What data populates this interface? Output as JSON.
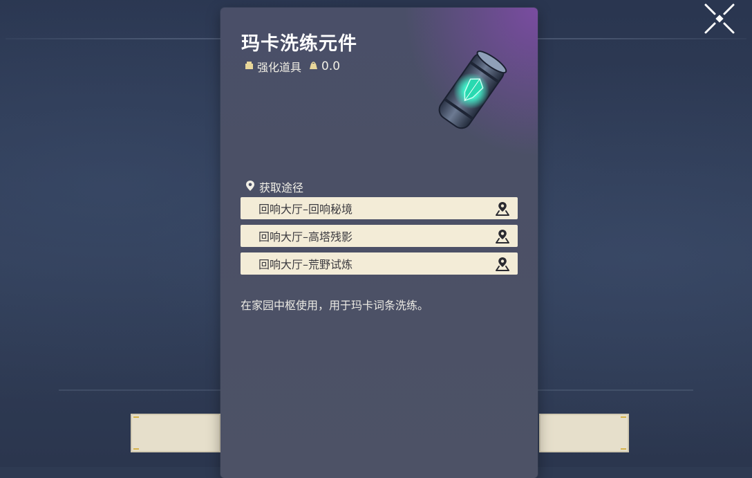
{
  "item": {
    "name": "玛卡洗练元件",
    "type_label": "强化道具",
    "value_label": "0.0",
    "icon_name": "energy-cylinder-icon",
    "description": "在家园中枢使用，用于玛卡词条洗练。"
  },
  "sources": {
    "header": "获取途径",
    "items": [
      {
        "label": "回响大厅–回响秘境",
        "icon": "map-location-icon"
      },
      {
        "label": "回响大厅–高塔残影",
        "icon": "map-location-icon"
      },
      {
        "label": "回响大厅–荒野试炼",
        "icon": "map-location-icon"
      }
    ]
  },
  "colors": {
    "card_bg": "#4b5066",
    "card_glow": "#8a4bb0",
    "row_bg": "#f3ecd7",
    "accent_teal": "#3ef0c8"
  }
}
